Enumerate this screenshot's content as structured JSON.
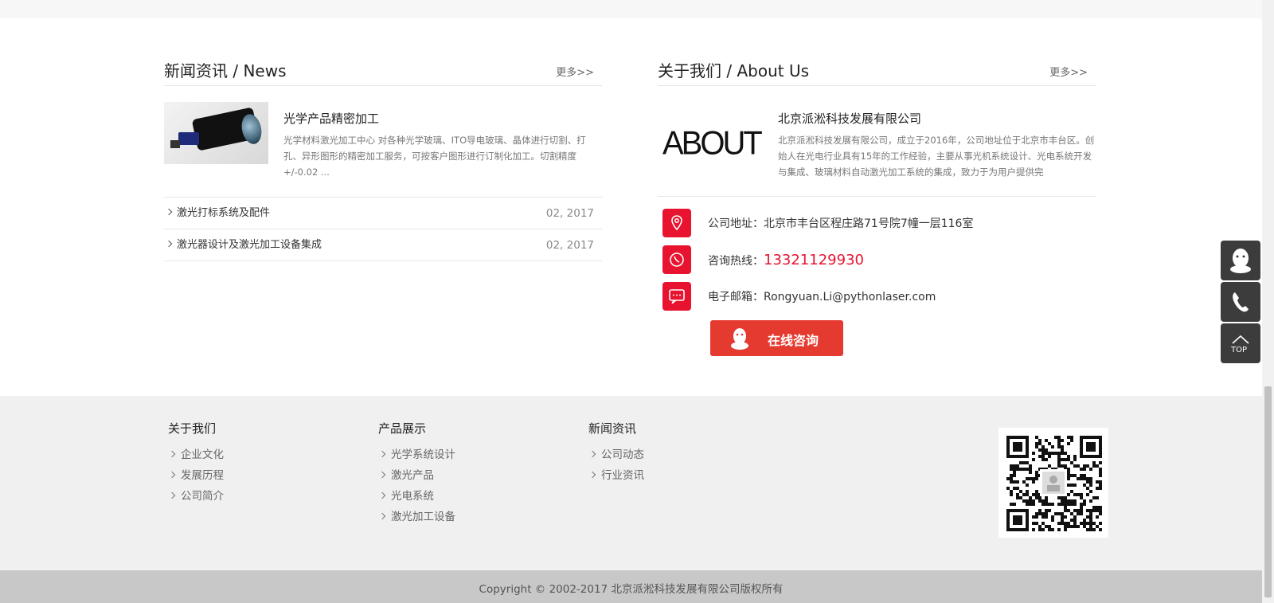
{
  "news": {
    "title": "新闻资讯 / News",
    "more": "更多>>",
    "feature": {
      "title": "光学产品精密加工",
      "desc": "光学材料激光加工中心 对各种光学玻璃、ITO导电玻璃、晶体进行切割、打孔、异形图形的精密加工服务，可按客户图形进行订制化加工。切割精度+/-0.02 ..."
    },
    "items": [
      {
        "label": "激光打标系统及配件",
        "date": "02, 2017"
      },
      {
        "label": "激光器设计及激光加工设备集成",
        "date": "02, 2017"
      }
    ]
  },
  "about": {
    "title": "关于我们 / About Us",
    "more": "更多>>",
    "logo_text": "ABOUT",
    "company": "北京派淞科技发展有限公司",
    "desc": "北京派淞科技发展有限公司，成立于2016年，公司地址位于北京市丰台区。创始人在光电行业具有15年的工作经验，主要从事光机系统设计、光电系统开发与集成、玻璃材料自动激光加工系统的集成，致力于为用户提供完",
    "address_label": "公司地址：",
    "address": "北京市丰台区程庄路71号院7幢一层116室",
    "phone_label": "咨询热线：",
    "phone": "13321129930",
    "email_label": "电子邮箱：",
    "email": "Rongyuan.Li@pythonlaser.com",
    "consult_button": "在线咨询"
  },
  "sidebar": {
    "top_label": "TOP"
  },
  "footer": {
    "columns": [
      {
        "heading": "关于我们",
        "links": [
          "企业文化",
          "发展历程",
          "公司简介"
        ]
      },
      {
        "heading": "产品展示",
        "links": [
          "光学系统设计",
          "激光产品",
          "光电系统",
          "激光加工设备"
        ]
      },
      {
        "heading": "新闻资讯",
        "links": [
          "公司动态",
          "行业资讯"
        ]
      }
    ],
    "copyright": "Copyright © 2002-2017 北京派淞科技发展有限公司版权所有"
  },
  "colors": {
    "accent_red": "#e8132f",
    "button_red": "#e53a2f",
    "side_dark": "#3c3c3c"
  }
}
